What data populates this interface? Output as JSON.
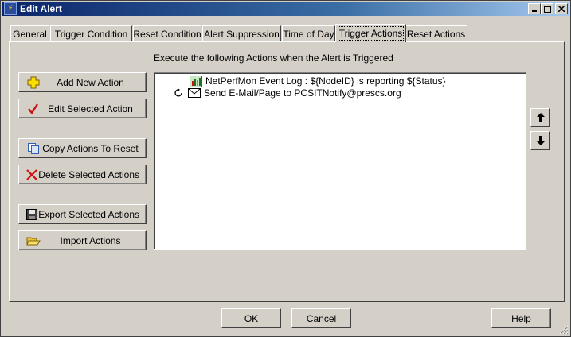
{
  "window": {
    "title": "Edit Alert",
    "controls": {
      "minimize": "_",
      "maximize": "□",
      "close": "✕"
    }
  },
  "tabs": [
    {
      "label": "General",
      "active": false
    },
    {
      "label": "Trigger Condition",
      "active": false
    },
    {
      "label": "Reset Condition",
      "active": false
    },
    {
      "label": "Alert Suppression",
      "active": false
    },
    {
      "label": "Time of Day",
      "active": false
    },
    {
      "label": "Trigger Actions",
      "active": true
    },
    {
      "label": "Reset Actions",
      "active": false
    }
  ],
  "panel": {
    "header": "Execute the following Actions when the Alert is Triggered"
  },
  "side_buttons": {
    "add": {
      "label": "Add New Action",
      "icon": "plus-icon"
    },
    "edit": {
      "label": "Edit Selected Action",
      "icon": "checkmark-icon"
    },
    "copy": {
      "label": "Copy Actions To Reset",
      "icon": "copy-icon"
    },
    "delete": {
      "label": "Delete Selected Actions",
      "icon": "delete-x-icon"
    },
    "export": {
      "label": "Export Selected Actions",
      "icon": "floppy-disk-icon"
    },
    "import": {
      "label": "Import Actions",
      "icon": "open-folder-icon"
    }
  },
  "actions": [
    {
      "text": "NetPerfMon Event Log : ${NodeID} is reporting ${Status}",
      "icon": "event-log-icon",
      "repeat": false
    },
    {
      "text": "Send E-Mail/Page to PCSITNotify@prescs.org",
      "icon": "envelope-icon",
      "repeat": true
    }
  ],
  "order_buttons": {
    "up": "arrow-up-icon",
    "down": "arrow-down-icon"
  },
  "footer": {
    "ok": "OK",
    "cancel": "Cancel",
    "help": "Help"
  },
  "colors": {
    "face": "#d4d0c8",
    "title_start": "#0a246a",
    "title_end": "#a6caf0",
    "delete_red": "#d01010",
    "add_yellow": "#f8e000"
  }
}
